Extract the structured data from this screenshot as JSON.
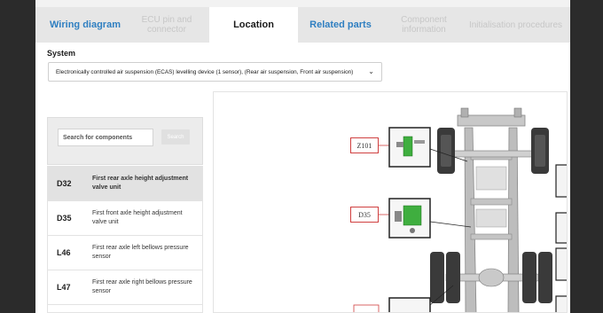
{
  "tabs": [
    {
      "label": "Wiring diagram",
      "state": "link"
    },
    {
      "label": "ECU pin and connector",
      "state": "disabled"
    },
    {
      "label": "Location",
      "state": "active"
    },
    {
      "label": "Related parts",
      "state": "link"
    },
    {
      "label": "Component information",
      "state": "disabled"
    },
    {
      "label": "Initialisation procedures",
      "state": "disabled"
    }
  ],
  "system": {
    "label": "System",
    "selected": "Electronically controlled air suspension (ECAS) levelling device (1 sensor), (Rear air suspension, Front air suspension)"
  },
  "search": {
    "placeholder": "Search for components",
    "button": "Search"
  },
  "components": [
    {
      "code": "D32",
      "description": "First rear axle height adjustment valve unit",
      "selected": true
    },
    {
      "code": "D35",
      "description": "First front axle height adjustment valve unit",
      "selected": false
    },
    {
      "code": "L46",
      "description": "First rear axle left bellows pressure sensor",
      "selected": false
    },
    {
      "code": "L47",
      "description": "First rear axle right bellows pressure sensor",
      "selected": false
    }
  ],
  "diagram": {
    "callouts": [
      "Z101",
      "D35"
    ]
  },
  "colors": {
    "link": "#2f7fc1",
    "disabled": "#c7c7c7",
    "callout_border": "#d04040",
    "highlight_component": "#3fae3f"
  }
}
